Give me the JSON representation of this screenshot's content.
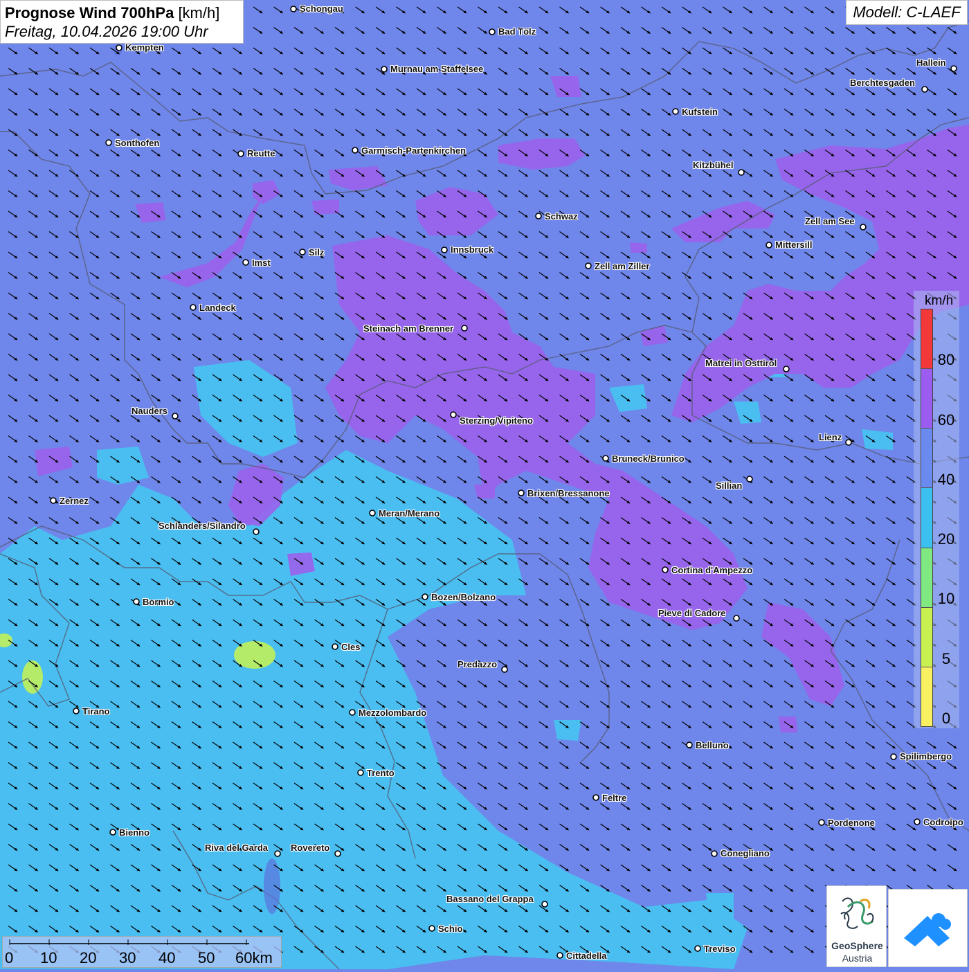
{
  "title": {
    "main": "Prognose Wind 700hPa",
    "unit": "[km/h]",
    "datetime": "Freitag, 10.04.2026 19:00 Uhr"
  },
  "model": "Modell: C-LAEF",
  "legend": {
    "unit": "km/h",
    "labels": [
      "80",
      "60",
      "40",
      "20",
      "10",
      "5",
      "0"
    ],
    "colors": [
      "#f23838",
      "#9b5cf0",
      "#6a8af0",
      "#3cc0f0",
      "#80e880",
      "#c8f050",
      "#f8f060"
    ]
  },
  "colors": {
    "base": "#6f86ea",
    "speed_40_60": "#9b62ec",
    "speed_20_40": "#44c8f2",
    "speed_10_20": "#b4ec6a",
    "border": "#5a5a6e"
  },
  "cities": [
    {
      "name": "Schongau"
    },
    {
      "name": "Bad Tölz"
    },
    {
      "name": "Kempten"
    },
    {
      "name": "Murnau am Staffelsee"
    },
    {
      "name": "Hallein"
    },
    {
      "name": "Berchtesgaden"
    },
    {
      "name": "Kufstein"
    },
    {
      "name": "Sonthofen"
    },
    {
      "name": "Reutte"
    },
    {
      "name": "Garmisch-Partenkirchen"
    },
    {
      "name": "Kitzbühel"
    },
    {
      "name": "Schwaz"
    },
    {
      "name": "Zell am See"
    },
    {
      "name": "Mittersill"
    },
    {
      "name": "Silz"
    },
    {
      "name": "Innsbruck"
    },
    {
      "name": "Imst"
    },
    {
      "name": "Zell am Ziller"
    },
    {
      "name": "Landeck"
    },
    {
      "name": "Steinach am Brenner"
    },
    {
      "name": "Matrei in Osttirol"
    },
    {
      "name": "Nauders"
    },
    {
      "name": "Sterzing/Vipiteno"
    },
    {
      "name": "Lienz"
    },
    {
      "name": "Bruneck/Brunico"
    },
    {
      "name": "Sillian"
    },
    {
      "name": "Zernez"
    },
    {
      "name": "Brixen/Bressanone"
    },
    {
      "name": "Meran/Merano"
    },
    {
      "name": "Schlanders/Silandro"
    },
    {
      "name": "Cortina d'Ampezzo"
    },
    {
      "name": "Bozen/Bolzano"
    },
    {
      "name": "Bormio"
    },
    {
      "name": "Pieve di Cadore"
    },
    {
      "name": "Cles"
    },
    {
      "name": "Predazzo"
    },
    {
      "name": "Tirano"
    },
    {
      "name": "Mezzolombardo"
    },
    {
      "name": "Belluno"
    },
    {
      "name": "Spilimbergo"
    },
    {
      "name": "Trento"
    },
    {
      "name": "Feltre"
    },
    {
      "name": "Pordenone"
    },
    {
      "name": "Codroipo"
    },
    {
      "name": "Bienno"
    },
    {
      "name": "Riva del Garda"
    },
    {
      "name": "Rovereto"
    },
    {
      "name": "Conegliano"
    },
    {
      "name": "Bassano del Grappa"
    },
    {
      "name": "Schio"
    },
    {
      "name": "Treviso"
    },
    {
      "name": "Cittadella"
    }
  ],
  "scale": {
    "labels": [
      "0",
      "10",
      "20",
      "30",
      "40",
      "50",
      "60km"
    ]
  },
  "logos": {
    "geosphere_name": "GeoSphere",
    "geosphere_sub": "Austria"
  },
  "wind": {
    "direction": "northwest-to-southeast"
  }
}
